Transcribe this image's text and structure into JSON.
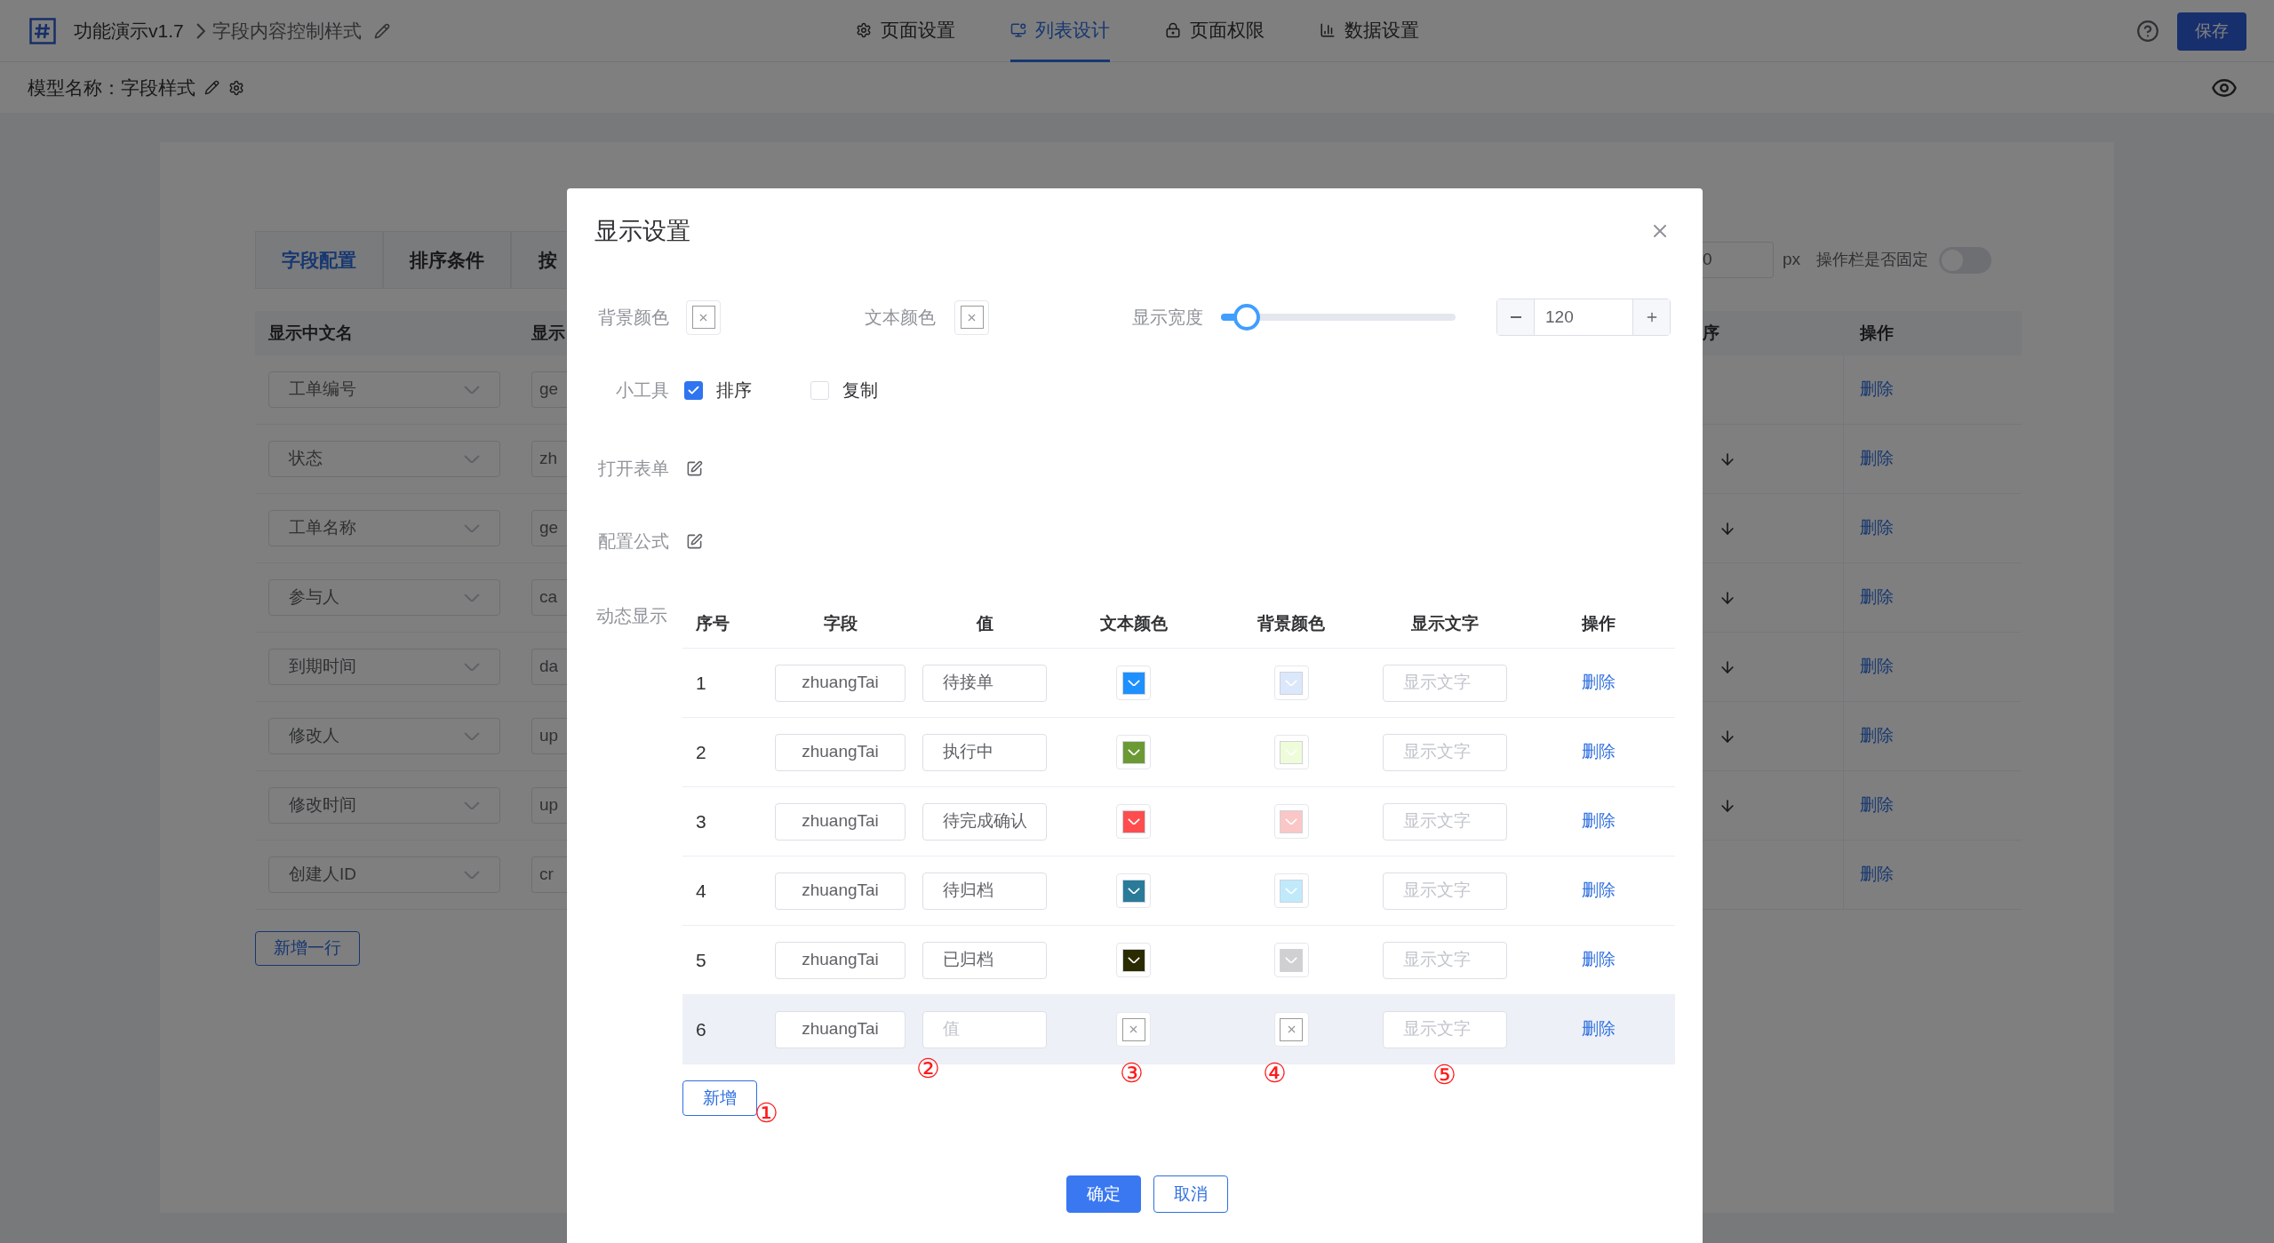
{
  "header": {
    "title": "功能演示v1.7",
    "breadcrumb": "字段内容控制样式",
    "tabs": [
      {
        "label": "页面设置",
        "selected": false
      },
      {
        "label": "列表设计",
        "selected": true
      },
      {
        "label": "页面权限",
        "selected": false
      },
      {
        "label": "数据设置",
        "selected": false
      }
    ],
    "save_button": "保存"
  },
  "model_bar": {
    "label": "模型名称：",
    "name": "字段样式"
  },
  "background": {
    "tabs": [
      {
        "label": "字段配置",
        "selected": true
      },
      {
        "label": "排序条件",
        "selected": false
      },
      {
        "label": "按",
        "selected": false
      }
    ],
    "columns": [
      "显示中文名",
      "显示"
    ],
    "rows": [
      {
        "name": "工单编号",
        "field": "ge",
        "sort_arrow": false,
        "action": "删除"
      },
      {
        "name": "状态",
        "field": "zh",
        "sort_arrow": true,
        "action": "删除"
      },
      {
        "name": "工单名称",
        "field": "ge",
        "sort_arrow": true,
        "action": "删除"
      },
      {
        "name": "参与人",
        "field": "ca",
        "sort_arrow": true,
        "action": "删除"
      },
      {
        "name": "到期时间",
        "field": "da",
        "sort_arrow": true,
        "action": "删除"
      },
      {
        "name": "修改人",
        "field": "up",
        "sort_arrow": true,
        "action": "删除"
      },
      {
        "name": "修改时间",
        "field": "up",
        "sort_arrow": true,
        "action": "删除"
      },
      {
        "name": "创建人ID",
        "field": "cr",
        "sort_arrow": false,
        "action": "删除"
      }
    ],
    "add_row_button": "新增一行",
    "width_input": "0",
    "unit": "px",
    "fixed_label": "操作栏是否固定",
    "fixed_on": false,
    "right_columns": [
      "序",
      "操作"
    ]
  },
  "modal": {
    "title": "显示设置",
    "bg_color": {
      "label": "背景颜色"
    },
    "text_color": {
      "label": "文本颜色"
    },
    "width": {
      "label": "显示宽度",
      "level": 0.11,
      "value": "120"
    },
    "tools": {
      "label": "小工具",
      "options": [
        {
          "label": "排序",
          "checked": true
        },
        {
          "label": "复制",
          "checked": false
        }
      ]
    },
    "open_form": {
      "label": "打开表单"
    },
    "formula": {
      "label": "配置公式"
    },
    "dynamic": {
      "label": "动态显示",
      "columns": [
        "序号",
        "字段",
        "值",
        "文本颜色",
        "背景颜色",
        "显示文字",
        "操作"
      ],
      "rows": [
        {
          "index": "1",
          "field": "zhuangTai",
          "value": "待接单",
          "text_swatch": {
            "color": "#1e90ff"
          },
          "bg_swatch": {
            "color": "#dbe8fb"
          },
          "label_placeholder": "显示文字",
          "action": "删除",
          "selected": false
        },
        {
          "index": "2",
          "field": "zhuangTai",
          "value": "执行中",
          "text_swatch": {
            "color": "#6b9a35"
          },
          "bg_swatch": {
            "color": "#effcd9"
          },
          "label_placeholder": "显示文字",
          "action": "删除",
          "selected": false
        },
        {
          "index": "3",
          "field": "zhuangTai",
          "value": "待完成确认",
          "text_swatch": {
            "color": "#ff4d4f"
          },
          "bg_swatch": {
            "color": "#fbc6c6"
          },
          "label_placeholder": "显示文字",
          "action": "删除",
          "selected": false
        },
        {
          "index": "4",
          "field": "zhuangTai",
          "value": "待归档",
          "text_swatch": {
            "color": "#2a7a9a"
          },
          "bg_swatch": {
            "color": "#c0eafc"
          },
          "label_placeholder": "显示文字",
          "action": "删除",
          "selected": false
        },
        {
          "index": "5",
          "field": "zhuangTai",
          "value": "已归档",
          "text_swatch": {
            "color": "#2b2b00"
          },
          "bg_swatch": {
            "color": "#d0d0d0"
          },
          "label_placeholder": "显示文字",
          "action": "删除",
          "selected": false
        },
        {
          "index": "6",
          "field": "zhuangTai",
          "value_placeholder": "值",
          "label_placeholder": "显示文字",
          "action": "删除",
          "selected": true,
          "notes": {
            "value": "②",
            "text_color": "③",
            "bg_color": "④",
            "label": "⑤"
          }
        }
      ],
      "add_button": {
        "label": "新增",
        "note": "①"
      }
    },
    "footer": [
      {
        "label": "确定",
        "kind": "primary"
      },
      {
        "label": "取消",
        "kind": "secondary"
      }
    ]
  }
}
